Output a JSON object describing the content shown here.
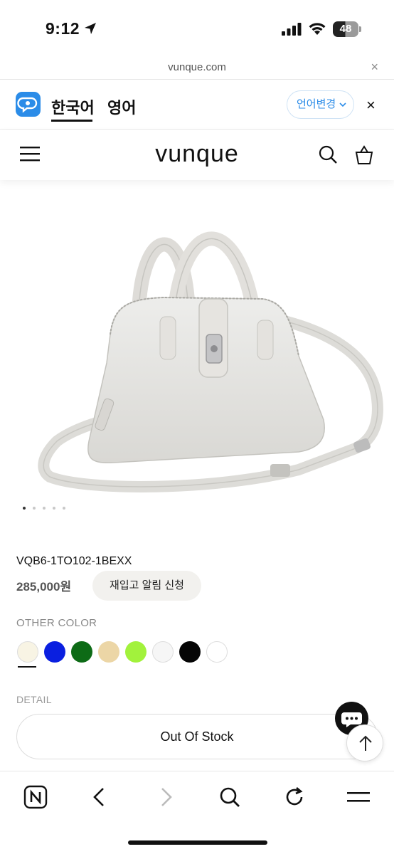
{
  "status": {
    "time": "9:12",
    "battery": "48"
  },
  "urlbar": {
    "url": "vunque.com",
    "close": "×"
  },
  "translate": {
    "tab_korean": "한국어",
    "tab_english": "영어",
    "change_language": "언어변경",
    "close": "×"
  },
  "site": {
    "brand": "vunque"
  },
  "product": {
    "image_dots_total": 5,
    "image_dots_active": 1,
    "code": "VQB6-1TO102-1BEXX",
    "price": "285,000원",
    "restock_button": "재입고 알림 신청",
    "other_color_label": "OTHER COLOR",
    "colors": [
      "#f8f4e4",
      "#0a1fe0",
      "#0d6b16",
      "#ecd6a6",
      "#a2f23c",
      "#f6f6f6",
      "#050505",
      "#ffffff"
    ],
    "detail_label": "DETAIL",
    "out_of_stock": "Out Of Stock"
  }
}
